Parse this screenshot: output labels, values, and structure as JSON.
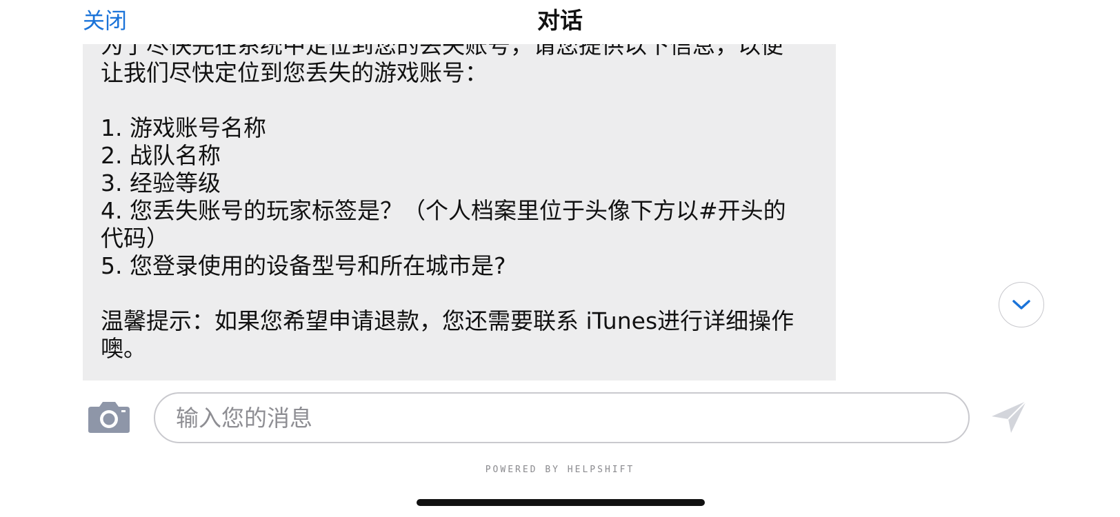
{
  "header": {
    "close_label": "关闭",
    "title": "对话"
  },
  "message": {
    "lines": [
      "为了尽快完在系统中定位到您的丢失账号，请您提供以下信息，以便",
      "让我们尽快定位到您丢失的游戏账号：",
      "",
      "1. 游戏账号名称",
      "2. 战队名称",
      "3. 经验等级",
      "4. 您丢失账号的玩家标签是？（个人档案里位于头像下方以#开头的",
      "代码）",
      "5. 您登录使用的设备型号和所在城市是?",
      "",
      "温馨提示：如果您希望申请退款，您还需要联系 iTunes进行详细操作",
      "噢。"
    ]
  },
  "composer": {
    "input_placeholder": "输入您的消息",
    "input_value": ""
  },
  "footer": {
    "powered_by": "POWERED BY HELPSHIFT"
  },
  "colors": {
    "accent": "#1a73d9",
    "bubble_background": "#ededee",
    "icon_gray": "#8e96a8",
    "send_disabled": "#d3d5db"
  },
  "icons": {
    "camera": "camera-icon",
    "send": "send-icon",
    "scroll_down": "chevron-down-icon"
  }
}
